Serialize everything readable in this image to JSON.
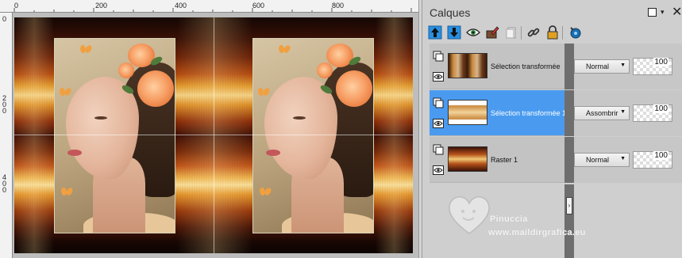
{
  "palette": {
    "title": "Calques",
    "layers": [
      {
        "name": "Sélection transformée",
        "blend_mode": "Normal",
        "opacity": "100",
        "selected": false
      },
      {
        "name": "Sélection transformée 1",
        "blend_mode": "Assombrir",
        "opacity": "100",
        "selected": true
      },
      {
        "name": "Raster 1",
        "blend_mode": "Normal",
        "opacity": "100",
        "selected": false
      }
    ],
    "toolbar_icons": [
      "move-layer-up-icon",
      "move-layer-down-icon",
      "visibility-icon",
      "edit-layer-icon",
      "delete-layer-icon",
      "link-layer-icon",
      "lock-layer-icon",
      "palette-settings-icon"
    ]
  },
  "ruler": {
    "top_labels": [
      "0",
      "200",
      "400",
      "600",
      "800"
    ],
    "left_labels": [
      "0",
      "2\n0\n0",
      "4\n0\n0"
    ]
  },
  "watermark": {
    "line1": "Pinuccia",
    "line2": "www.maildirgrafica.eu"
  },
  "colors": {
    "selection": "#4a9bf0",
    "palette_bg": "#cfcfcf"
  }
}
